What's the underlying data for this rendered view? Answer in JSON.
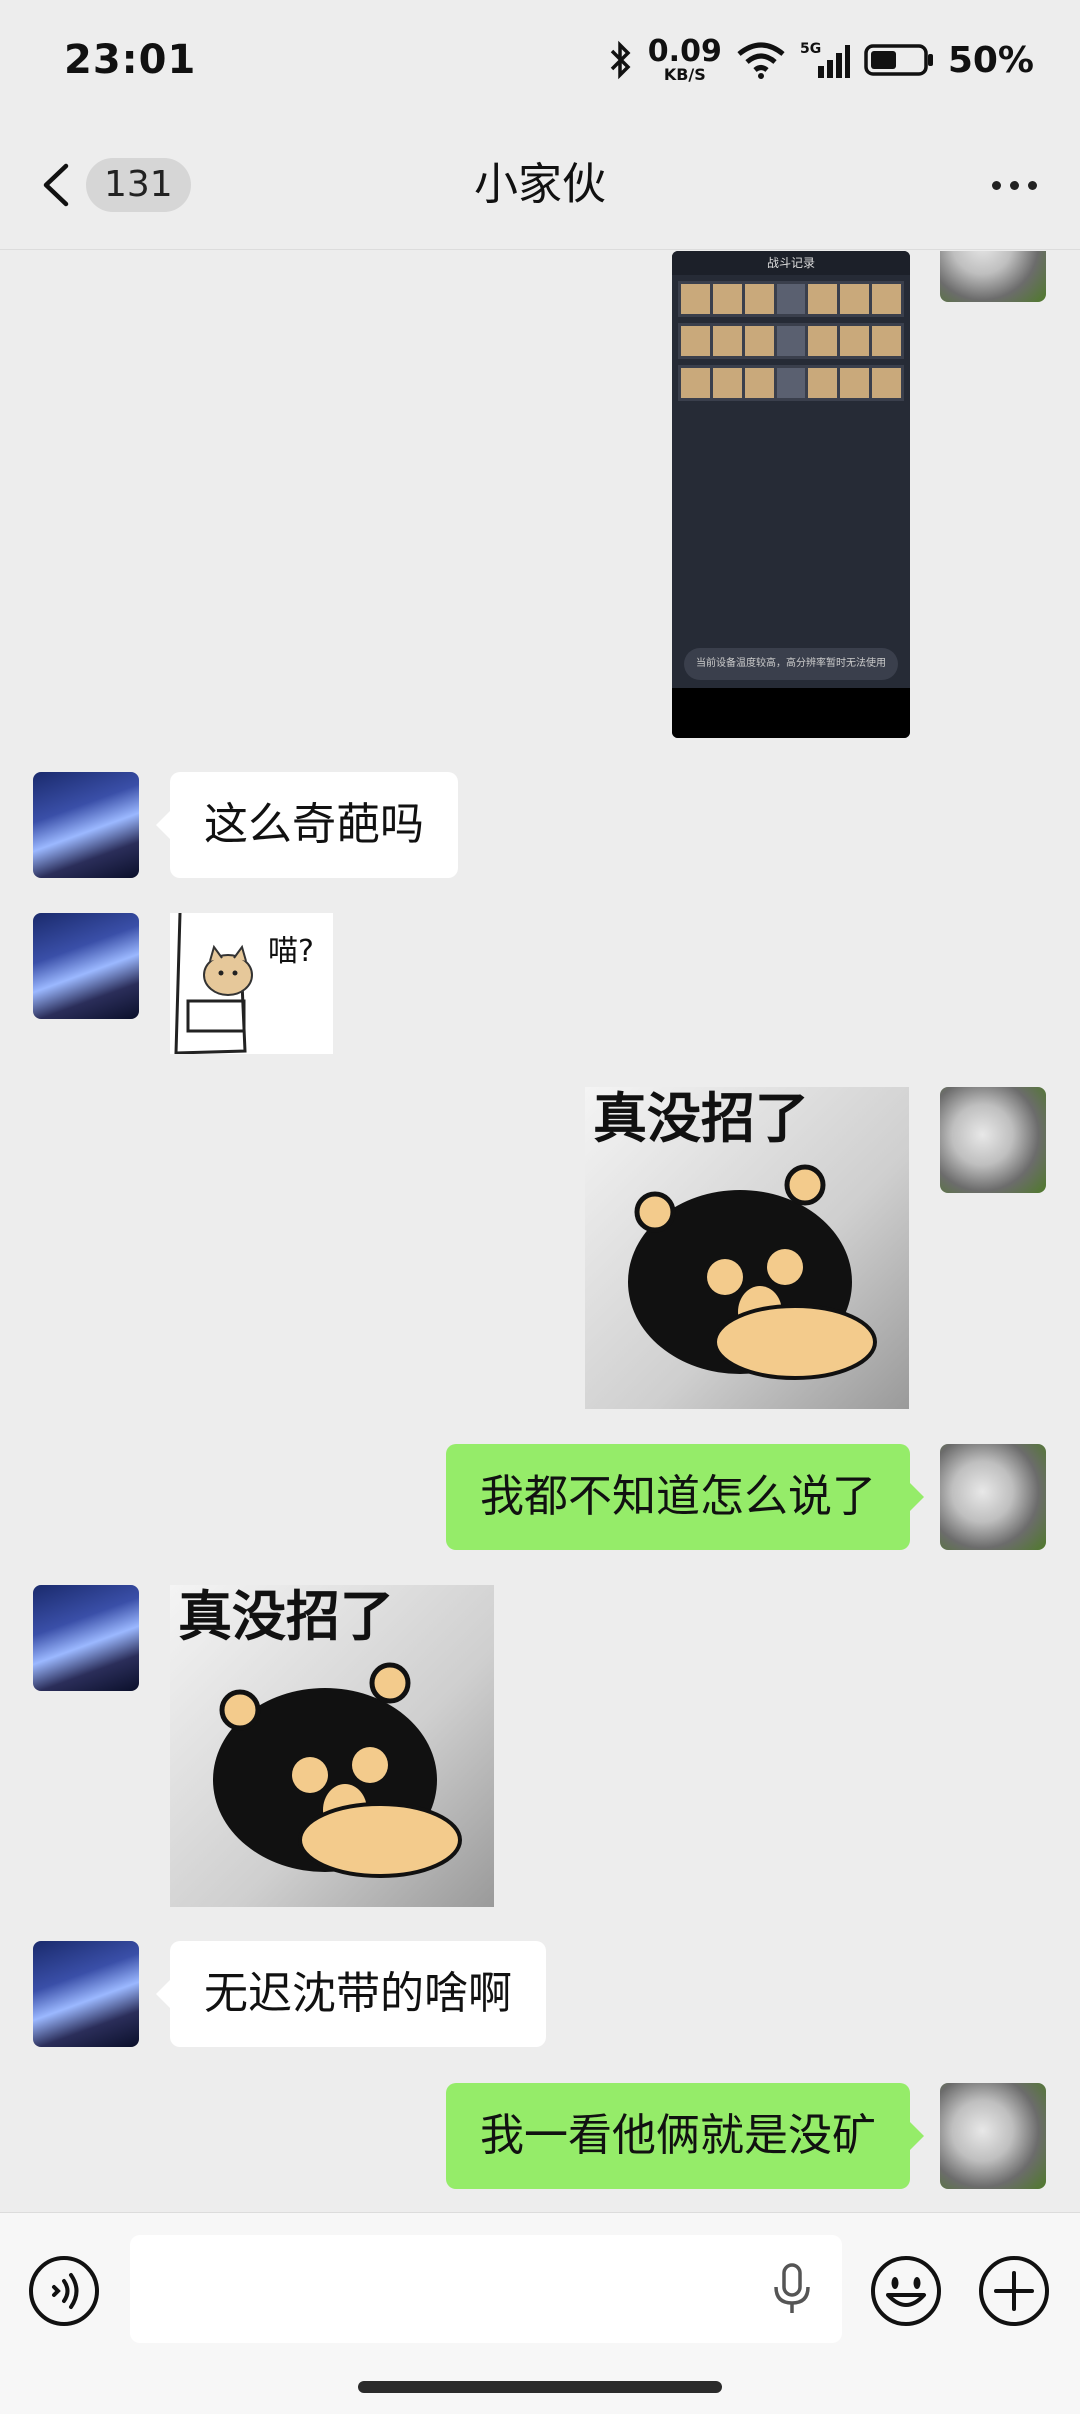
{
  "status_bar": {
    "time": "23:01",
    "net_speed_value": "0.09",
    "net_speed_unit": "KB/S",
    "network_type": "5G",
    "battery_percent": "50%",
    "battery_level": 0.5
  },
  "nav": {
    "unread_count": "131",
    "title": "小家伙"
  },
  "screenshot_message": {
    "header_text": "战斗记录",
    "footer_text": "当前设备温度较高，高分辨率暂时无法使用"
  },
  "messages": [
    {
      "side": "left",
      "type": "text",
      "text": "这么奇葩吗"
    },
    {
      "side": "left",
      "type": "sticker",
      "sticker_text": "喵?"
    },
    {
      "side": "right",
      "type": "sticker",
      "sticker_text": "真没招了"
    },
    {
      "side": "right",
      "type": "text",
      "text": "我都不知道怎么说了"
    },
    {
      "side": "left",
      "type": "sticker",
      "sticker_text": "真没招了"
    },
    {
      "side": "left",
      "type": "text",
      "text": "无迟沈带的啥啊"
    },
    {
      "side": "right",
      "type": "text",
      "text": "我一看他俩就是没矿"
    }
  ],
  "input": {
    "placeholder": ""
  },
  "icons": {
    "back": "chevron-left-icon",
    "more": "more-dots-icon",
    "voice": "voice-icon",
    "mic": "mic-icon",
    "emoji": "emoji-icon",
    "plus": "plus-icon"
  },
  "colors": {
    "background": "#ededed",
    "bubble_sent": "#95ec69",
    "bubble_received": "#ffffff"
  }
}
